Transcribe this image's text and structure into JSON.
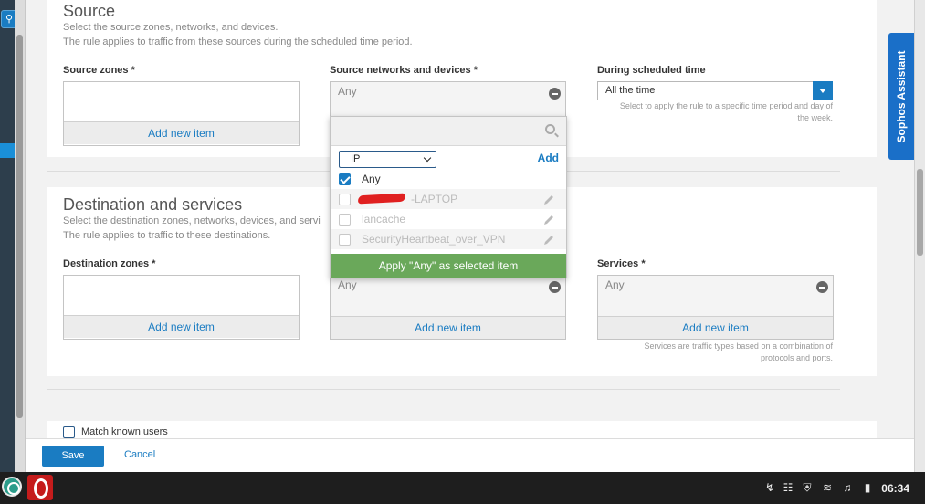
{
  "source": {
    "title": "Source",
    "desc_line1": "Select the source zones, networks, and devices.",
    "desc_line2": "The rule applies to traffic from these sources during the scheduled time period.",
    "zones_label": "Source zones *",
    "zones_add": "Add new item",
    "networks_label": "Source networks and devices *",
    "networks_value": "Any",
    "schedule_label": "During scheduled time",
    "schedule_value": "All the time",
    "schedule_hint": "Select to apply the rule to a specific time period and day of the week."
  },
  "dropdown": {
    "search_placeholder": "",
    "type_value": "IP",
    "add_label": "Add",
    "items": [
      {
        "label": "Any",
        "checked": true
      },
      {
        "label": "-LAPTOP",
        "checked": false
      },
      {
        "label": "lancache",
        "checked": false
      },
      {
        "label": "SecurityHeartbeat_over_VPN",
        "checked": false
      }
    ],
    "apply_label": "Apply \"Any\" as selected item"
  },
  "destination": {
    "title": "Destination and services",
    "desc_line1": "Select the destination zones, networks, devices, and servi",
    "desc_line2": "The rule applies to traffic to these destinations.",
    "zones_label": "Destination zones *",
    "zones_add": "Add new item",
    "networks_value": "Any",
    "networks_add": "Add new item",
    "services_label": "Services *",
    "services_value": "Any",
    "services_add": "Add new item",
    "services_hint": "Services are traffic types based on a combination of protocols and ports."
  },
  "match_users": {
    "label": "Match known users"
  },
  "footer": {
    "save": "Save",
    "cancel": "Cancel"
  },
  "assistant": {
    "label": "Sophos Assistant"
  },
  "taskbar": {
    "clock": "06:34"
  },
  "colors": {
    "accent": "#1a7cc2",
    "apply_green": "#6aa85a",
    "assistant_blue": "#1a6fc8"
  }
}
